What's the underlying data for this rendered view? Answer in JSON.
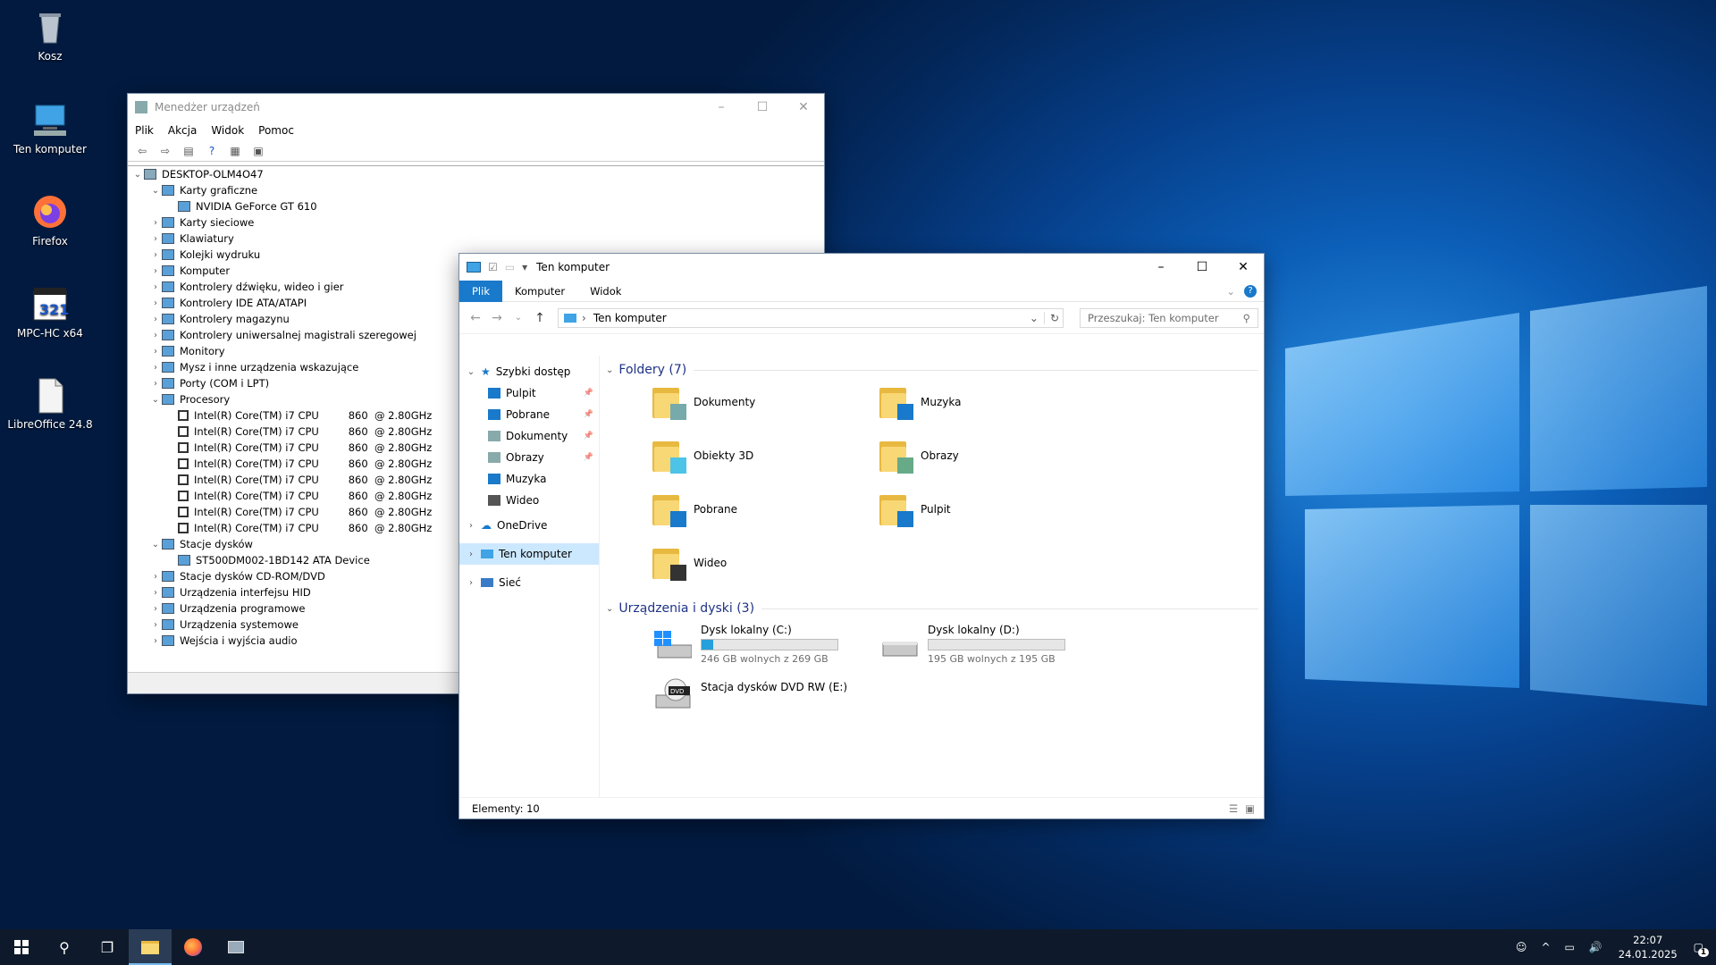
{
  "desktop": {
    "icons": [
      {
        "label": "Kosz",
        "icon": "recycle-bin-icon"
      },
      {
        "label": "Ten komputer",
        "icon": "computer-icon"
      },
      {
        "label": "Firefox",
        "icon": "firefox-icon"
      },
      {
        "label": "MPC-HC x64",
        "icon": "mpc-hc-icon"
      },
      {
        "label": "LibreOffice 24.8",
        "icon": "libreoffice-icon"
      }
    ]
  },
  "devmgr": {
    "title": "Menedżer urządzeń",
    "menu": [
      "Plik",
      "Akcja",
      "Widok",
      "Pomoc"
    ],
    "root": "DESKTOP-OLM4O47",
    "tree": [
      {
        "label": "Karty graficzne",
        "expanded": true,
        "level": 1
      },
      {
        "label": "NVIDIA GeForce GT 610",
        "level": 2
      },
      {
        "label": "Karty sieciowe",
        "level": 1
      },
      {
        "label": "Klawiatury",
        "level": 1
      },
      {
        "label": "Kolejki wydruku",
        "level": 1
      },
      {
        "label": "Komputer",
        "level": 1
      },
      {
        "label": "Kontrolery dźwięku, wideo i gier",
        "level": 1
      },
      {
        "label": "Kontrolery IDE ATA/ATAPI",
        "level": 1
      },
      {
        "label": "Kontrolery magazynu",
        "level": 1
      },
      {
        "label": "Kontrolery uniwersalnej magistrali szeregowej",
        "level": 1
      },
      {
        "label": "Monitory",
        "level": 1
      },
      {
        "label": "Mysz i inne urządzenia wskazujące",
        "level": 1
      },
      {
        "label": "Porty (COM i LPT)",
        "level": 1
      },
      {
        "label": "Procesory",
        "expanded": true,
        "level": 1
      },
      {
        "label": "Intel(R) Core(TM) i7 CPU         860  @ 2.80GHz",
        "level": 2,
        "cpu": true
      },
      {
        "label": "Intel(R) Core(TM) i7 CPU         860  @ 2.80GHz",
        "level": 2,
        "cpu": true
      },
      {
        "label": "Intel(R) Core(TM) i7 CPU         860  @ 2.80GHz",
        "level": 2,
        "cpu": true
      },
      {
        "label": "Intel(R) Core(TM) i7 CPU         860  @ 2.80GHz",
        "level": 2,
        "cpu": true
      },
      {
        "label": "Intel(R) Core(TM) i7 CPU         860  @ 2.80GHz",
        "level": 2,
        "cpu": true
      },
      {
        "label": "Intel(R) Core(TM) i7 CPU         860  @ 2.80GHz",
        "level": 2,
        "cpu": true
      },
      {
        "label": "Intel(R) Core(TM) i7 CPU         860  @ 2.80GHz",
        "level": 2,
        "cpu": true
      },
      {
        "label": "Intel(R) Core(TM) i7 CPU         860  @ 2.80GHz",
        "level": 2,
        "cpu": true
      },
      {
        "label": "Stacje dysków",
        "expanded": true,
        "level": 1
      },
      {
        "label": "ST500DM002-1BD142 ATA Device",
        "level": 2
      },
      {
        "label": "Stacje dysków CD-ROM/DVD",
        "level": 1
      },
      {
        "label": "Urządzenia interfejsu HID",
        "level": 1
      },
      {
        "label": "Urządzenia programowe",
        "level": 1
      },
      {
        "label": "Urządzenia systemowe",
        "level": 1
      },
      {
        "label": "Wejścia i wyjścia audio",
        "level": 1
      }
    ]
  },
  "explorer": {
    "title": "Ten komputer",
    "tabs": [
      "Plik",
      "Komputer",
      "Widok"
    ],
    "address": "Ten komputer",
    "search_placeholder": "Przeszukaj: Ten komputer",
    "nav": {
      "quick_access": "Szybki dostęp",
      "quick_items": [
        "Pulpit",
        "Pobrane",
        "Dokumenty",
        "Obrazy",
        "Muzyka",
        "Wideo"
      ],
      "onedrive": "OneDrive",
      "this_pc": "Ten komputer",
      "network": "Sieć"
    },
    "folders_header": "Foldery (7)",
    "folders": [
      {
        "label": "Dokumenty",
        "icon": "documents-folder-icon"
      },
      {
        "label": "Muzyka",
        "icon": "music-folder-icon"
      },
      {
        "label": "Obiekty 3D",
        "icon": "3d-objects-folder-icon"
      },
      {
        "label": "Obrazy",
        "icon": "pictures-folder-icon"
      },
      {
        "label": "Pobrane",
        "icon": "downloads-folder-icon"
      },
      {
        "label": "Pulpit",
        "icon": "desktop-folder-icon"
      },
      {
        "label": "Wideo",
        "icon": "videos-folder-icon"
      }
    ],
    "drives_header": "Urządzenia i dyski (3)",
    "drives": [
      {
        "label": "Dysk lokalny (C:)",
        "free": "246 GB wolnych z 269 GB",
        "used_fraction": 0.085
      },
      {
        "label": "Dysk lokalny (D:)",
        "free": "195 GB wolnych z 195 GB",
        "used_fraction": 0.0
      },
      {
        "label": "Stacja dysków DVD RW (E:)"
      }
    ],
    "status": "Elementy: 10"
  },
  "taskbar": {
    "time": "22:07",
    "date": "24.01.2025",
    "notifications": "1"
  },
  "colors": {
    "accent": "#1979ca",
    "selection": "#cce8ff",
    "drive_bar": "#26a0da"
  }
}
